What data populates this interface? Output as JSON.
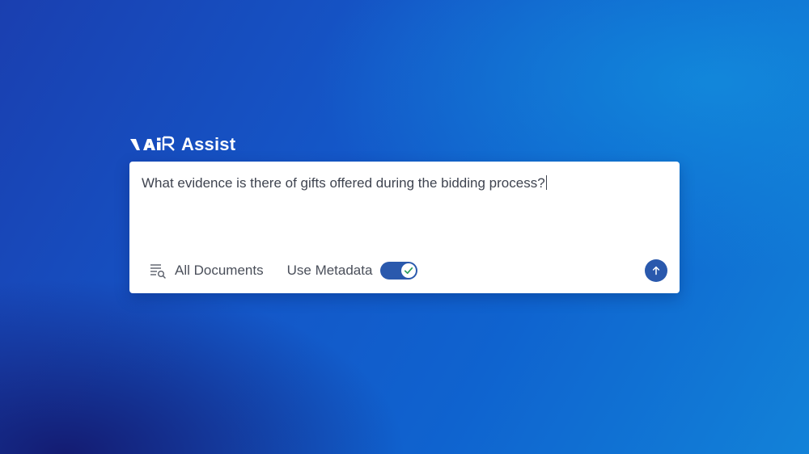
{
  "brand": {
    "logo_text": "aiR",
    "name": "Assist"
  },
  "prompt": {
    "value": "What evidence is there of gifts offered during the bidding process?"
  },
  "toolbar": {
    "document_filter_label": "All Documents",
    "document_filter_icon": "document-search-icon",
    "metadata_label": "Use Metadata",
    "metadata_enabled": true,
    "send_icon": "arrow-up-icon"
  },
  "colors": {
    "accent": "#2a59ad",
    "card_background": "#ffffff",
    "text": "#3f4450"
  }
}
